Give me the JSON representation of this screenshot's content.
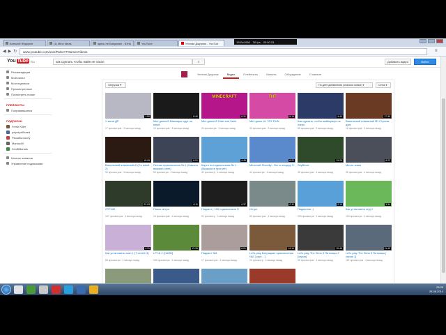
{
  "browser": {
    "tabs": [
      {
        "title": "Алексей Федорин"
      },
      {
        "title": "(1) Mine Ideas"
      },
      {
        "title": "здесь не Ванданих - ЮНи"
      },
      {
        "title": "YouTube"
      },
      {
        "title": "Утиная Джурник - YouTub",
        "active": true
      }
    ],
    "url": "www.youtube.com/user/RoboYTGamesVideos",
    "overlay": [
      "1920x1080",
      "30 fps",
      "00:00:23"
    ]
  },
  "youtube": {
    "logo_you": "You",
    "logo_tube": "Tube",
    "lang": "RU",
    "search_value": "как сделать чтобы майн не лагал",
    "upload_label": "Добавить видео",
    "signin_label": "Войти"
  },
  "sidebar": {
    "main": [
      {
        "label": "Рекомендации",
        "icon": "home-icon"
      },
      {
        "label": "Мой канал",
        "icon": "user-icon"
      },
      {
        "label": "Мои подписки",
        "icon": "subscriptions-icon"
      },
      {
        "label": "Просмотренные",
        "icon": "history-icon"
      },
      {
        "label": "Посмотреть позже",
        "icon": "clock-icon"
      }
    ],
    "playlists_header": "ПЛЕЙЛИСТЫ",
    "playlists": [
      {
        "label": "Понравившиеся",
        "icon": "like-icon"
      }
    ],
    "subs_header": "ПОДПИСКИ",
    "subs": [
      {
        "label": "Fresh Killer",
        "color": "#7a5a3a"
      },
      {
        "label": "pxlpxlpxl8ceed",
        "color": "#4a6a9a"
      },
      {
        "label": "Рюоябьнокогу",
        "color": "#b44"
      },
      {
        "label": "Maniac00",
        "color": "#666"
      },
      {
        "label": "ZenBiBonats",
        "color": "#3a8a4a"
      }
    ],
    "footer": [
      {
        "label": "Каталог каналов",
        "icon": "plus-circle-icon"
      },
      {
        "label": "Управление подписками",
        "icon": "gear-icon"
      }
    ]
  },
  "channel": {
    "nav": [
      "Уютная Джурник",
      "Видео",
      "Плейлисты",
      "Каналы",
      "Обсуждение",
      "О канале"
    ],
    "active_nav": 1,
    "uploads_label": "Загрузки",
    "sort_label": "По дате добавления (сначала новые)",
    "grid_label": "Сетка"
  },
  "videos": [
    {
      "title": "У меня ДР",
      "meta": "17 просмотров · 3 месяца назад",
      "dur": "1:50",
      "bg": "#b8b8c4",
      "tt": ""
    },
    {
      "title": "Mini game#3 Вампиры идут за мной",
      "meta": "10 просмотров · 3 месяца назад",
      "dur": "8:40",
      "bg": "#1a1a1a",
      "tt": ""
    },
    {
      "title": "Mini game#2 Hide and Seek",
      "meta": "24 просмотра · 3 месяца назад",
      "dur": "6:31",
      "bg": "#b5178a",
      "tt": "MINECRAFT"
    },
    {
      "title": "Mini game #1 TNT RUN",
      "meta": "30 просмотров · 3 месяца назад",
      "dur": "5:19",
      "bg": "#d44aa4",
      "tt": "TNT"
    },
    {
      "title": "Как сделать чтобы майнкрафт не лагал",
      "meta": "55 просмотров · 3 месяца назад",
      "dur": "4:44",
      "bg": "#2b3a66",
      "tt": ""
    },
    {
      "title": "Ванильный алмазный 3D Строим дом",
      "meta": "16 просмотров · 3 месяца назад",
      "dur": "17:39",
      "bg": "#6a3a22",
      "tt": ""
    },
    {
      "title": "Ванильный алмазный #1(Со мной 2)",
      "meta": "39 просмотров · 4 месяца назад",
      "dur": "15:09",
      "bg": "#2a1a12",
      "tt": ""
    },
    {
      "title": "Летние приключения № 1 (Начало выжили селе)",
      "meta": "53 просмотра · 4 месяца назад",
      "dur": "6:01",
      "bg": "#3c4456",
      "tt": ""
    },
    {
      "title": "Карта по подписчикам № 1 (Выжили в пустоте)",
      "meta": "31 просмотр · 4 месяца назад",
      "dur": "4:45",
      "bg": "#5da1d6",
      "tt": ""
    },
    {
      "title": "Minecraft Sheniky - Бег в пещеру !!!",
      "meta": "44 просмотра · 4 месяца назад",
      "dur": "6:22",
      "bg": "#5a8acb",
      "tt": ""
    },
    {
      "title": "SkyBlock",
      "meta": "35 просмотров · 4 месяца назад",
      "dur": "19:29",
      "bg": "#2f4a2a",
      "tt": ""
    },
    {
      "title": "Месть зомы",
      "meta": "39 просмотров · 4 месяца назад",
      "dur": "6:22",
      "bg": "#4a4f5a",
      "tt": ""
    },
    {
      "title": "СТРИМ",
      "meta": "107 просмотров · 4 месяца назад",
      "dur": "22:03",
      "bg": "#2e3a2a",
      "tt": ""
    },
    {
      "title": "Поиск интро",
      "meta": "16 просмотров · 4 месяца назад",
      "dur": "0:11",
      "bg": "#0a1a2a",
      "tt": ""
    },
    {
      "title": "Подкаст | 100 подписчиков !!!",
      "meta": "21 просмотр · 4 месяца назад",
      "dur": "0:37",
      "bg": "#1e1e1e",
      "tt": ""
    },
    {
      "title": "Интро",
      "meta": "80 просмотров · 4 месяца назад",
      "dur": "0:11",
      "bg": "#7a8a8a",
      "tt": ""
    },
    {
      "title": "Подкастик :)",
      "meta": "103 просмотра · 4 месяца назад",
      "dur": "2:10",
      "bg": "#5aa0d8",
      "tt": ""
    },
    {
      "title": "Как установить игру?",
      "meta": "153 просмотра · 4 месяца назад",
      "dur": "3:34",
      "bg": "#6ab85a",
      "tt": ""
    },
    {
      "title": "Как установить скин 1 [Т сетей:/3]",
      "meta": "83 просмотра · 4 месяца назад",
      "dur": "4:31",
      "bg": "#c9b0d6",
      "tt": ""
    },
    {
      "title": "LP № 2 [HARD]",
      "meta": "153 просмотра · 4 месяца назад",
      "dur": "13:26",
      "bg": "#5a8a3a",
      "tt": ""
    },
    {
      "title": "Подкаст №1",
      "meta": "17 просмотров · 4 месяца назад",
      "dur": "6:01",
      "bg": "#ab9d9b",
      "tt": ""
    },
    {
      "title": "Let's play Батрацкие приключения №2 [ какт... ]",
      "meta": "21 просмотр · 4 месяца назад",
      "dur": "14:10",
      "bg": "#7a5a3a",
      "tt": ""
    },
    {
      "title": "Let's play The Sims 3 Питомцы 2 [серия]",
      "meta": "39 просмотров · 4 месяца назад",
      "dur": "10:46",
      "bg": "#3a3a3a",
      "tt": ""
    },
    {
      "title": "Let's play The Sims 3 Питомцы [ серия 1]",
      "meta": "187 просмотров · 4 месяца назад",
      "dur": "11:40",
      "bg": "#5a6a7a",
      "tt": ""
    },
    {
      "title": "",
      "meta": "",
      "dur": "",
      "bg": "#8a9a7a",
      "tt": ""
    },
    {
      "title": "",
      "meta": "",
      "dur": "",
      "bg": "#3a5a8a",
      "tt": ""
    },
    {
      "title": "",
      "meta": "",
      "dur": "",
      "bg": "#6aa0c8",
      "tt": ""
    },
    {
      "title": "",
      "meta": "",
      "dur": "",
      "bg": "#9a3a2a",
      "tt": ""
    }
  ],
  "tray": {
    "time": "23:09",
    "date": "28.08.2014"
  }
}
